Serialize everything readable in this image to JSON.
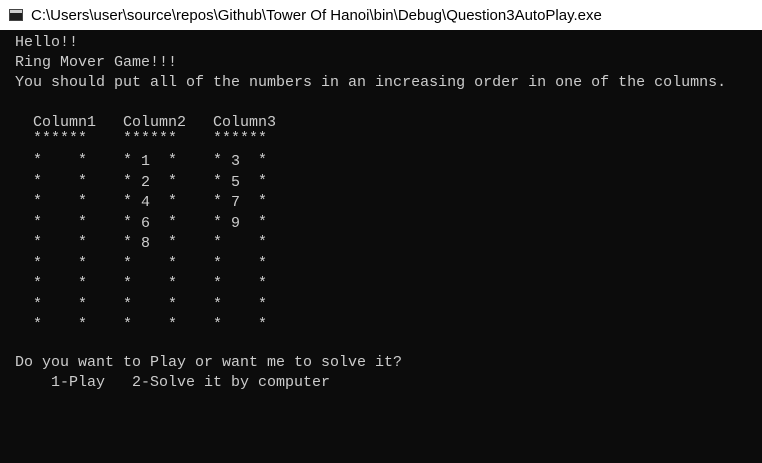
{
  "window": {
    "title": "C:\\Users\\user\\source\\repos\\Github\\Tower Of Hanoi\\bin\\Debug\\Question3AutoPlay.exe",
    "icon": "console-app-icon"
  },
  "console": {
    "greeting": "Hello!!",
    "game_title": "Ring Mover Game!!!",
    "instruction": "You should put all of the numbers in an increasing order in one of the columns.",
    "columns": [
      {
        "header": "Column1",
        "divider": "******",
        "rings": [
          "",
          "",
          "",
          "",
          "",
          "",
          "",
          "",
          ""
        ]
      },
      {
        "header": "Column2",
        "divider": "******",
        "rings": [
          "1",
          "2",
          "4",
          "6",
          "8",
          "",
          "",
          "",
          ""
        ]
      },
      {
        "header": "Column3",
        "divider": "******",
        "rings": [
          "3",
          "5",
          "7",
          "9",
          "",
          "",
          "",
          "",
          ""
        ]
      }
    ],
    "border_char": "*",
    "prompt": "Do you want to Play or want me to solve it?",
    "options": "1-Play   2-Solve it by computer"
  },
  "colors": {
    "background": "#0c0c0c",
    "text": "#cccccc",
    "titlebar": "#ffffff"
  }
}
